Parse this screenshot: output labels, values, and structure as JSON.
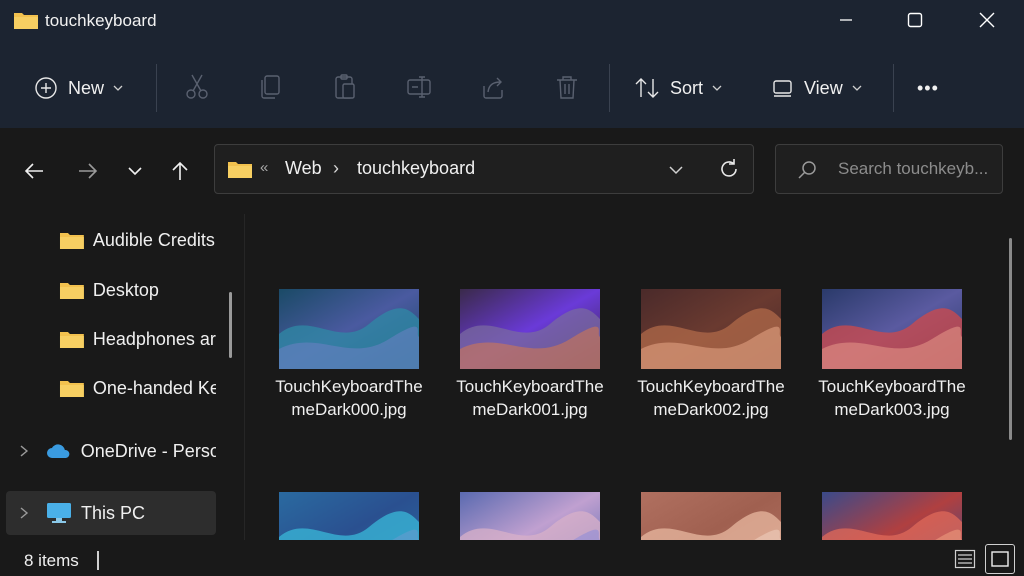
{
  "window": {
    "title": "touchkeyboard"
  },
  "toolbar": {
    "new_label": "New",
    "sort_label": "Sort",
    "view_label": "View",
    "more_label": "•••"
  },
  "address": {
    "overflow": "«",
    "crumbs": [
      "Web",
      "touchkeyboard"
    ],
    "separator": "›"
  },
  "search": {
    "placeholder": "Search touchkeyb..."
  },
  "sidebar": {
    "items": [
      {
        "label": "Audible Credits",
        "icon": "folder-icon"
      },
      {
        "label": "Desktop",
        "icon": "folder-icon"
      },
      {
        "label": "Headphones ar",
        "icon": "folder-icon"
      },
      {
        "label": "One-handed Ke",
        "icon": "folder-icon"
      },
      {
        "label": "OneDrive - Perso",
        "icon": "cloud-icon"
      },
      {
        "label": "This PC",
        "icon": "monitor-icon",
        "selected": true
      }
    ]
  },
  "files": [
    {
      "name": "TouchKeyboardThemeDark000.jpg",
      "colors": [
        "#1a4a66",
        "#2f8aa6",
        "#6d7fc4",
        "#4a5aa0"
      ]
    },
    {
      "name": "TouchKeyboardThemeDark001.jpg",
      "colors": [
        "#3a2a4a",
        "#7a6aa0",
        "#d87a4a",
        "#6a3ad8"
      ]
    },
    {
      "name": "TouchKeyboardThemeDark002.jpg",
      "colors": [
        "#4a2a2a",
        "#b06a4a",
        "#e8a888",
        "#6a3a30"
      ]
    },
    {
      "name": "TouchKeyboardThemeDark003.jpg",
      "colors": [
        "#2a3a6a",
        "#d04a4a",
        "#e89a8a",
        "#5a5aa0"
      ]
    },
    {
      "name": "",
      "colors": [
        "#2a6aa0",
        "#3ab8d8",
        "#6a9ad0",
        "#2a5090"
      ]
    },
    {
      "name": "",
      "colors": [
        "#5a6ab0",
        "#d8b0c8",
        "#8a8ad8",
        "#c0a0d0"
      ]
    },
    {
      "name": "",
      "colors": [
        "#b07060",
        "#e8b8a0",
        "#f0d0c0",
        "#a06050"
      ]
    },
    {
      "name": "",
      "colors": [
        "#3a4a8a",
        "#e06a5a",
        "#f0a080",
        "#b04040"
      ]
    }
  ],
  "status": {
    "items": "8 items"
  },
  "colors": {
    "chrome": "#1c2431",
    "background": "#191919",
    "folder": "#f2c14e",
    "onedrive": "#3a9be0",
    "thispc": "#4ab0e8"
  }
}
